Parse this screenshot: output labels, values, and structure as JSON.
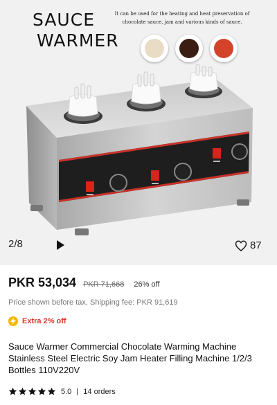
{
  "hero": {
    "title_line1": "SAUCE",
    "title_line2": "WARMER",
    "caption": "It can be used for the heating and heat preservation of chocolate sauce, jam and various kinds of sauce.",
    "bowl_colors": [
      "#e9dcc4",
      "#3b1d12",
      "#d2432a"
    ],
    "image_counter": "2/8",
    "likes": "87"
  },
  "product": {
    "price": "PKR 53,034",
    "original_price": "PKR 71,668",
    "discount": "26% off",
    "tax_note": "Price shown before tax, Shipping fee: PKR 91,619",
    "extra_offer": "Extra 2% off",
    "title": "Sauce Warmer Commercial Chocolate Warming Machine Stainless Steel Electric Soy Jam Heater Filling Machine 1/2/3 Bottles 110V220V",
    "rating": "5.0",
    "rating_stars": 5,
    "orders": "14 orders"
  },
  "colors": {
    "accent": "#e0372b",
    "bolt": "#f5b800",
    "switch": "#d7241c"
  }
}
